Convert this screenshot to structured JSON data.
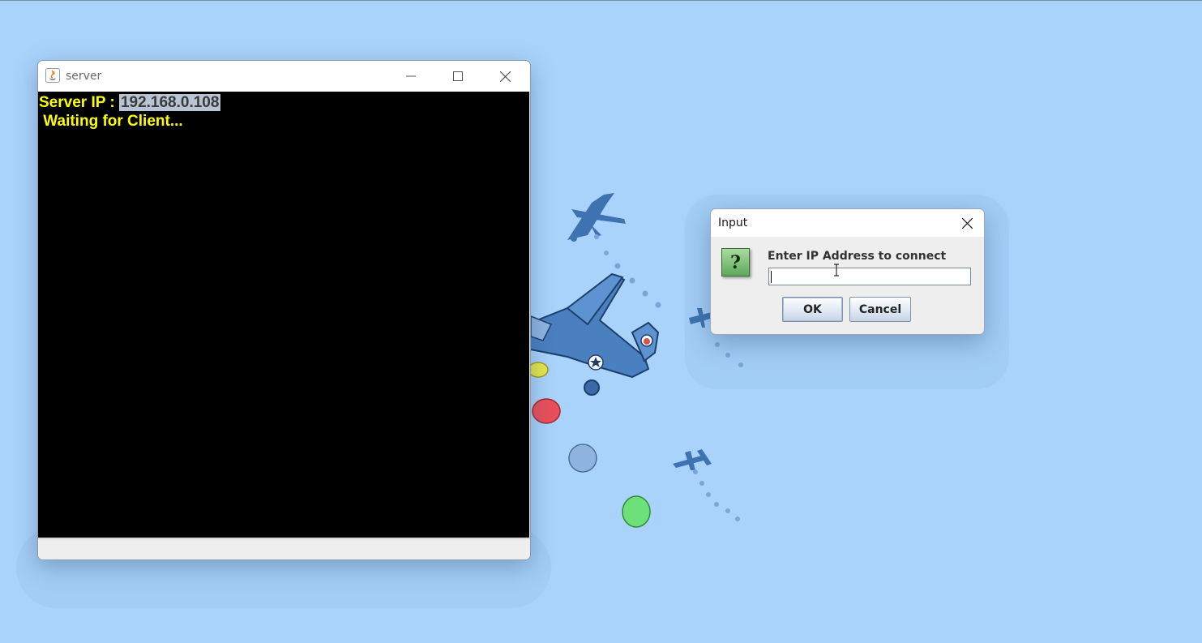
{
  "server_window": {
    "title": "server",
    "icon": "java-icon",
    "console_prefix": "Server IP : ",
    "server_ip": "192.168.0.108",
    "console_status": " Waiting for Client..."
  },
  "dialog": {
    "title": "Input",
    "icon": "question-icon",
    "icon_glyph": "?",
    "prompt": "Enter IP Address to connect",
    "input_value": "",
    "ok_label": "OK",
    "cancel_label": "Cancel"
  },
  "colors": {
    "desktop_background": "#a9d3fb",
    "console_background": "#000000",
    "console_text": "#ffff00",
    "selection_highlight": "#b8c4d4"
  }
}
